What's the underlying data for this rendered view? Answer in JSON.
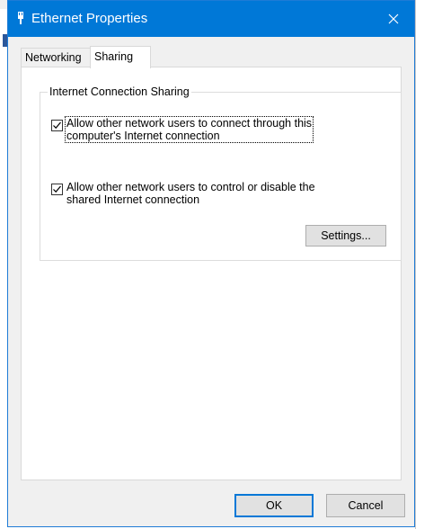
{
  "window": {
    "title": "Ethernet Properties",
    "close_icon": "close-icon",
    "title_icon": "network-adapter-icon"
  },
  "tabs": [
    {
      "label": "Networking",
      "selected": false
    },
    {
      "label": "Sharing",
      "selected": true
    }
  ],
  "sharing": {
    "group_label": "Internet Connection Sharing",
    "option1": {
      "label": "Allow other network users to connect through this\ncomputer's Internet connection",
      "checked": true
    },
    "option2": {
      "label": "Allow other network users to control or disable the\nshared Internet connection",
      "checked": true
    },
    "settings_label": "Settings..."
  },
  "buttons": {
    "ok_label": "OK",
    "cancel_label": "Cancel"
  },
  "colors": {
    "titlebar": "#0078d7",
    "accent_border": "#0078d7"
  }
}
